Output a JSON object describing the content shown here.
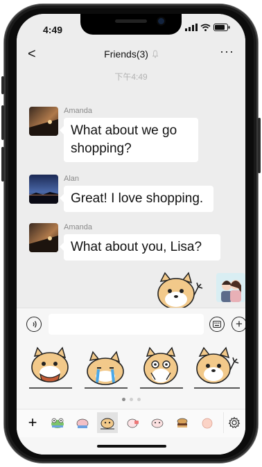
{
  "status_bar": {
    "time": "4:49"
  },
  "nav": {
    "back_label": "<",
    "title": "Friends(3)",
    "more_label": "···"
  },
  "chat": {
    "timestamp": "下午4:49",
    "messages": [
      {
        "sender": "Amanda",
        "text_line1": "What about we go",
        "text_line2": "shopping?"
      },
      {
        "sender": "Alan",
        "text": "Great! I love shopping."
      },
      {
        "sender": "Amanda",
        "text": "What about you, Lisa?"
      }
    ]
  },
  "input": {
    "voice_icon": "voice-icon",
    "keyboard_icon": "keyboard-icon",
    "plus_icon": "plus-icon",
    "plus_label": "+"
  },
  "stickers": {
    "page_dots": 3,
    "active_page": 1
  },
  "tray": {
    "add_label": "+"
  },
  "colors": {
    "background": "#ededed",
    "bubble": "#ffffff",
    "accent": "#f2c98a"
  }
}
